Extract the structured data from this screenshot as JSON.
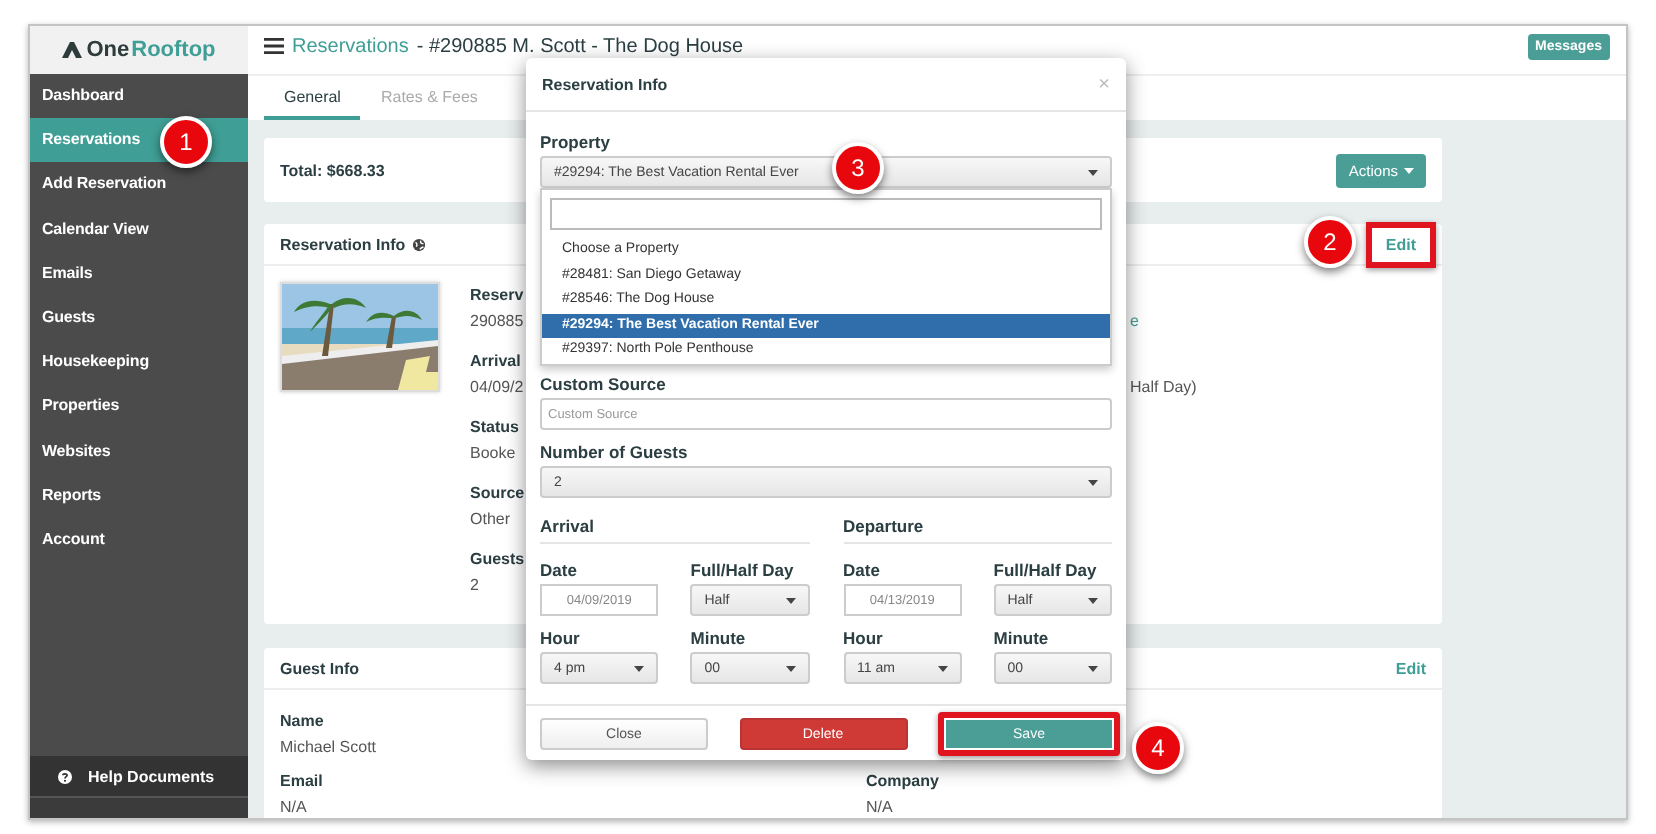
{
  "logo": {
    "parts": [
      "One",
      "Rooftop"
    ]
  },
  "sidebar": {
    "items": [
      {
        "label": "Dashboard",
        "selected": false
      },
      {
        "label": "Reservations",
        "selected": true
      },
      {
        "label": "Add Reservation",
        "selected": false
      },
      {
        "label": "Calendar View",
        "selected": false
      },
      {
        "label": "Emails",
        "selected": false
      },
      {
        "label": "Guests",
        "selected": false
      },
      {
        "label": "Housekeeping",
        "selected": false
      },
      {
        "label": "Properties",
        "selected": false
      },
      {
        "label": "Websites",
        "selected": false
      },
      {
        "label": "Reports",
        "selected": false
      },
      {
        "label": "Account",
        "selected": false
      }
    ],
    "help": "Help Documents"
  },
  "header": {
    "section": "Reservations",
    "title": "- #290885 M. Scott - The Dog House",
    "messages_button": "Messages"
  },
  "tabs": [
    {
      "label": "General",
      "selected": true
    },
    {
      "label": "Rates & Fees",
      "selected": false
    }
  ],
  "total": {
    "text": "Total: $668.33",
    "actions_button": "Actions"
  },
  "reservation_card": {
    "title": "Reservation Info",
    "edit": {
      "label": "Edit",
      "highlighted": true
    },
    "fields": [
      {
        "label": "Reserv",
        "value": "290885",
        "column_2": {
          "text": "e",
          "link": true
        }
      },
      {
        "label": "Arrival",
        "value": "04/09/2",
        "column_2": {
          "text": "Half Day)",
          "link": false
        }
      },
      {
        "label": "Status",
        "value": "Booke"
      },
      {
        "label": "Source",
        "value": "Other"
      },
      {
        "label": "Guests",
        "value": "2"
      }
    ]
  },
  "guest_card": {
    "title": "Guest Info",
    "edit": {
      "label": "Edit",
      "highlighted": false
    },
    "fields": [
      {
        "label": "Name",
        "value": "Michael Scott"
      },
      {
        "label": "Email",
        "value": "N/A"
      }
    ],
    "column_2": [
      {
        "label": "Company",
        "value": "N/A"
      }
    ]
  },
  "modal": {
    "title": "Reservation Info",
    "close": "×",
    "property": {
      "label": "Property",
      "value": "#29294: The Best Vacation Rental Ever",
      "expanded": true,
      "options": [
        {
          "label": "Choose a Property",
          "selected": false
        },
        {
          "label": "#28481: San Diego Getaway",
          "selected": false
        },
        {
          "label": "#28546: The Dog House",
          "selected": false
        },
        {
          "label": "#29294: The Best Vacation Rental Ever",
          "selected": true
        },
        {
          "label": "#29397: North Pole Penthouse",
          "selected": false
        }
      ]
    },
    "custom_source": {
      "label": "Custom Source",
      "placeholder": "Custom Source"
    },
    "guests": {
      "label": "Number of Guests",
      "value": "2"
    },
    "stays": [
      {
        "heading": "Arrival",
        "date_label": "Date",
        "date": "04/09/2019",
        "day_label": "Full/Half Day",
        "day": "Half",
        "hour_label": "Hour",
        "hour": "4 pm",
        "minute_label": "Minute",
        "minute": "00"
      },
      {
        "heading": "Departure",
        "date_label": "Date",
        "date": "04/13/2019",
        "day_label": "Full/Half Day",
        "day": "Half",
        "hour_label": "Hour",
        "hour": "11 am",
        "minute_label": "Minute",
        "minute": "00"
      }
    ],
    "buttons": [
      {
        "label": "Close",
        "kind": "default",
        "highlighted": false
      },
      {
        "label": "Delete",
        "kind": "danger",
        "highlighted": false
      },
      {
        "label": "Save",
        "kind": "primary",
        "highlighted": true
      }
    ]
  },
  "callouts": [
    {
      "number": "1"
    },
    {
      "number": "2"
    },
    {
      "number": "3"
    },
    {
      "number": "4"
    }
  ]
}
